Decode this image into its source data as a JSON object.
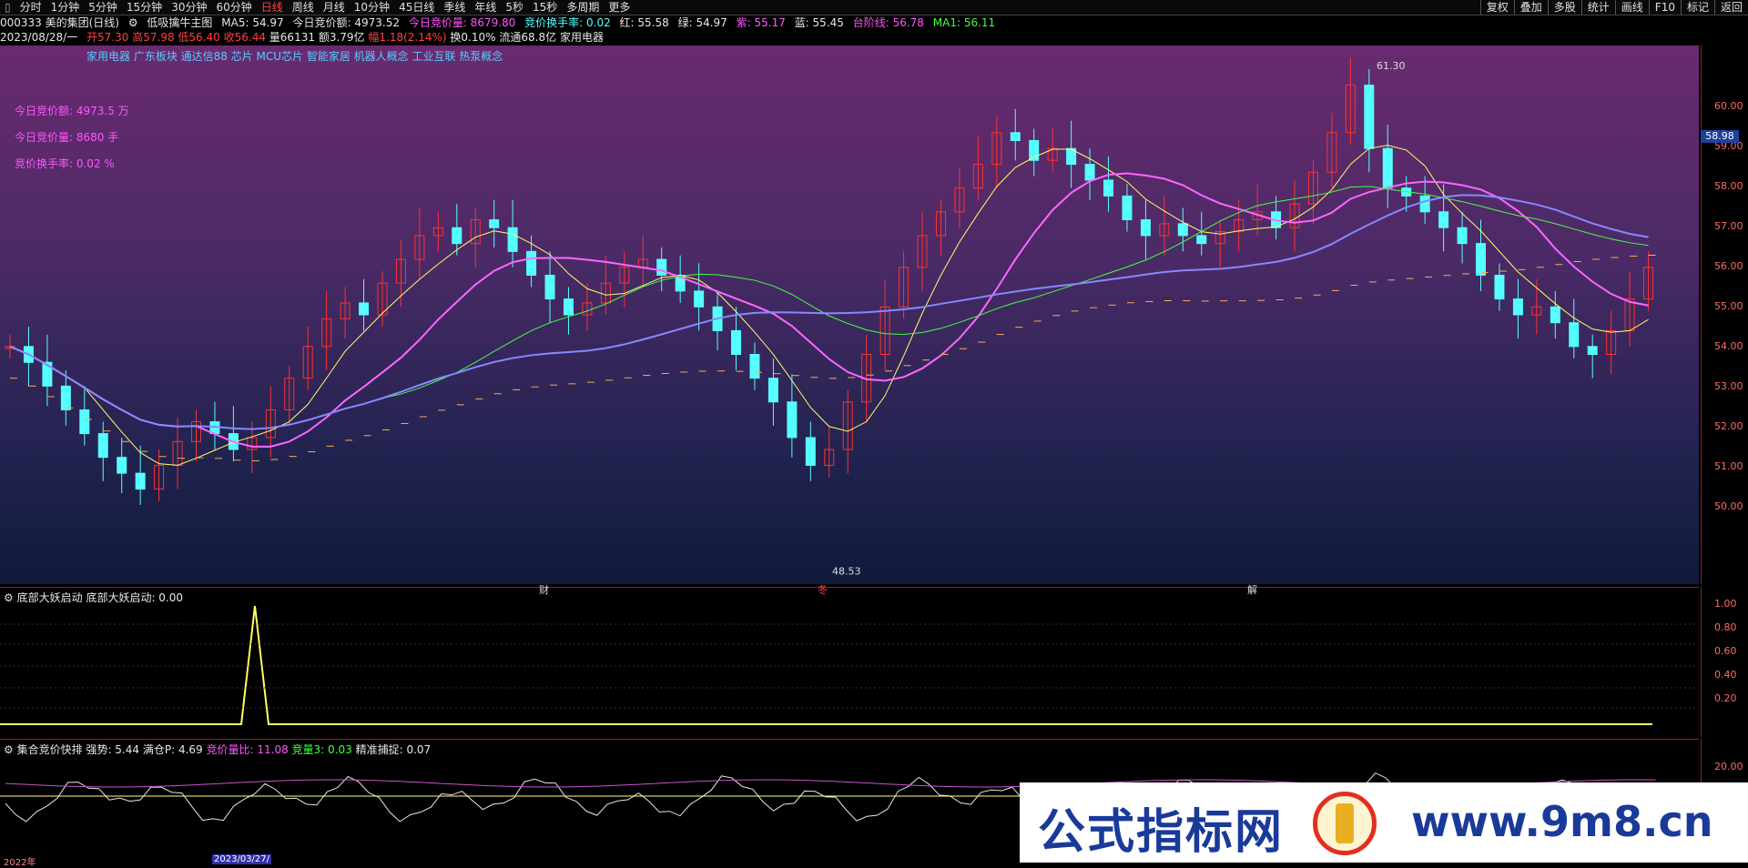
{
  "toolbar": {
    "periods": [
      "分时",
      "1分钟",
      "5分钟",
      "15分钟",
      "30分钟",
      "60分钟",
      "日线",
      "周线",
      "月线",
      "10分钟",
      "45日线",
      "季线",
      "年线",
      "5秒",
      "15秒",
      "多周期",
      "更多"
    ],
    "active_period": "日线",
    "right_buttons": [
      "复权",
      "叠加",
      "多股",
      "统计",
      "画线",
      "F10",
      "标记",
      "返回"
    ]
  },
  "header": {
    "stock": "000333 美的集团(日线)",
    "indicator": "低吸擒牛主图",
    "ma5": "MA5: 54.97",
    "today_amount": "今日竞价额: 4973.52",
    "today_vol": "今日竞价量: 8679.80",
    "turnover": "竞价换手率: 0.02",
    "red": "红: 55.58",
    "green": "绿: 54.97",
    "purple": "紫: 55.17",
    "blue": "蓝: 55.45",
    "step": "台阶线: 56.78",
    "ma1": "MA1: 56.11"
  },
  "quote": {
    "date": "2023/08/28/一",
    "open": "开57.30",
    "high": "高57.98",
    "low": "低56.40",
    "close": "收56.44",
    "vol": "量66131",
    "amount": "额3.79亿",
    "change": "幅1.18(2.14%)",
    "turn": "换0.10%",
    "float": "流通68.8亿",
    "industry": "家用电器"
  },
  "concepts": "家用电器 广东板块 通达信88 芯片 MCU芯片 智能家居 机器人概念 工业互联 热泵概念",
  "left_stats": {
    "amount": "今日竞价额: 4973.5 万",
    "volume": "今日竞价量: 8680 手",
    "turnover": "竞价换手率: 0.02 %"
  },
  "price_axis": {
    "ticks": [
      "60.00",
      "59.00",
      "58.00",
      "57.00",
      "56.00",
      "55.00",
      "54.00",
      "53.00",
      "52.00",
      "51.00",
      "50.00"
    ],
    "current": "58.98",
    "high_label": "61.30",
    "low_label": "48.53"
  },
  "x_markers": [
    "财",
    "冬",
    "解"
  ],
  "panel1": {
    "title": "底部大妖启动",
    "value": "底部大妖启动: 0.00",
    "ticks": [
      "1.00",
      "0.80",
      "0.60",
      "0.40",
      "0.20"
    ]
  },
  "panel2": {
    "title": "集合竞价快排",
    "strength": "强势: 5.44",
    "full": "满仓P: 4.69",
    "ratio": "竞价量比: 11.08",
    "vol3": "竞量3: 0.03",
    "precise": "精准捕捉: 0.07",
    "tick": "20.00",
    "date_label": "2023/03/27/",
    "year_label": "2022年"
  },
  "watermark": {
    "cn": "公式指标网",
    "url": "www.9m8.cn"
  },
  "colors": {
    "up": "#ff3030",
    "down": "#55ffff",
    "accent": "#ff4444"
  }
}
